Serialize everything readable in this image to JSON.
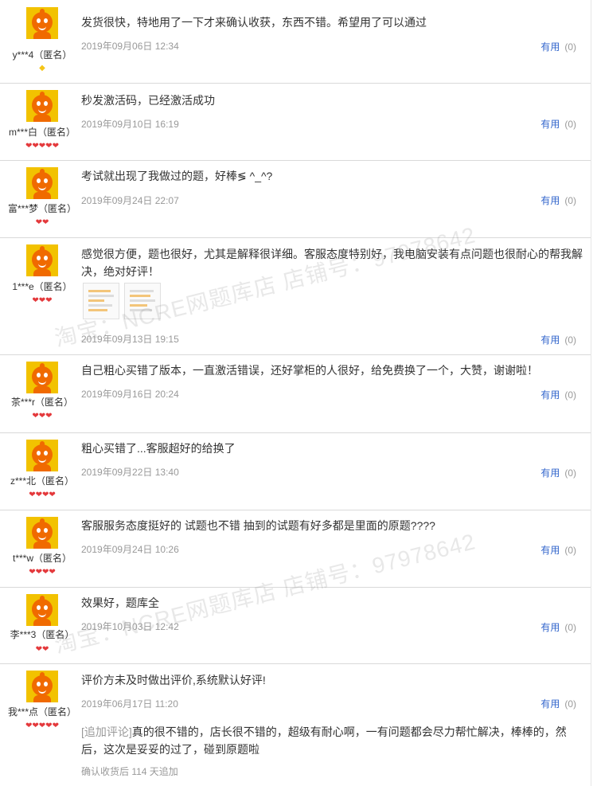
{
  "reviews": [
    {
      "user": "y***4（匿名）",
      "content": "发货很快，特地用了一下才来确认收获，东西不错。希望用了可以通过",
      "date": "2019年09月06日 12:34",
      "rank": "◆",
      "rank_icon": "gold-diamond-icon",
      "useful_label": "有用",
      "useful_count": "(0)"
    },
    {
      "user": "m***白（匿名）",
      "content": "秒发激活码，已经激活成功",
      "date": "2019年09月10日 16:19",
      "rank": "❤❤❤❤❤",
      "rank_icon": "red-heart-icon",
      "useful_label": "有用",
      "useful_count": "(0)"
    },
    {
      "user": "富***梦（匿名）",
      "content": "考试就出现了我做过的题，好棒≶ ^_^?",
      "date": "2019年09月24日 22:07",
      "rank": "❤❤",
      "rank_icon": "red-heart-icon",
      "useful_label": "有用",
      "useful_count": "(0)"
    },
    {
      "user": "1***e（匿名）",
      "content": "感觉很方便，题也很好，尤其是解释很详细。客服态度特别好，我电脑安装有点问题也很耐心的帮我解决，绝对好评！",
      "date": "2019年09月13日 19:15",
      "rank": "❤❤❤",
      "rank_icon": "red-heart-icon",
      "useful_label": "有用",
      "useful_count": "(0)"
    },
    {
      "user": "茶***r（匿名）",
      "content": "自己粗心买错了版本，一直激活错误，还好掌柜的人很好，给免费换了一个，大赞，谢谢啦！",
      "date": "2019年09月16日 20:24",
      "rank": "❤❤❤",
      "rank_icon": "red-heart-icon",
      "useful_label": "有用",
      "useful_count": "(0)"
    },
    {
      "user": "z***北（匿名）",
      "content": "粗心买错了...客服超好的给换了",
      "date": "2019年09月22日 13:40",
      "rank": "❤❤❤❤",
      "rank_icon": "red-heart-icon",
      "useful_label": "有用",
      "useful_count": "(0)"
    },
    {
      "user": "t***w（匿名）",
      "content": "客服服务态度挺好的 试题也不错 抽到的试题有好多都是里面的原题????",
      "date": "2019年09月24日 10:26",
      "rank": "❤❤❤❤",
      "rank_icon": "red-heart-icon",
      "useful_label": "有用",
      "useful_count": "(0)"
    },
    {
      "user": "李***3（匿名）",
      "content": "效果好，题库全",
      "date": "2019年10月03日 12:42",
      "rank": "❤❤",
      "rank_icon": "red-heart-icon",
      "useful_label": "有用",
      "useful_count": "(0)"
    },
    {
      "user": "我***点（匿名）",
      "content": "评价方未及时做出评价,系统默认好评!",
      "date": "2019年06月17日 11:20",
      "rank": "❤❤❤❤❤",
      "rank_icon": "red-heart-icon",
      "useful_label": "有用",
      "useful_count": "(0)",
      "append_tag": "[追加评论]",
      "append_text": "真的很不错的，店长很不错的，超级有耐心啊，一有问题都会尽力帮忙解决，棒棒的，然后，这次是妥妥的过了，碰到原题啦",
      "append_after": "确认收货后 114 天追加"
    }
  ],
  "watermarks": [
    "淘宝：NCRE网题库店  店铺号：97978642",
    "淘宝：NCRE网题库店  店铺号：97978642"
  ]
}
